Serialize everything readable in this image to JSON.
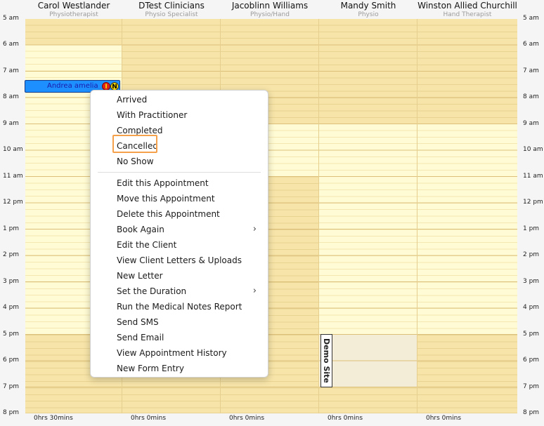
{
  "practitioners": [
    {
      "name": "Carol Westlander",
      "role": "Physiotherapist",
      "footer": "0hrs 30mins"
    },
    {
      "name": "DTest Clinicians",
      "role": "Physio Specialist",
      "footer": "0hrs 0mins"
    },
    {
      "name": "Jacoblinn Williams",
      "role": "Physio/Hand",
      "footer": "0hrs 0mins"
    },
    {
      "name": "Mandy Smith",
      "role": "Physio",
      "footer": "0hrs 0mins"
    },
    {
      "name": "Winston Allied Churchill",
      "role": "Hand Therapist",
      "footer": "0hrs 0mins"
    }
  ],
  "times": [
    "5 am",
    "6 am",
    "7 am",
    "8 am",
    "9 am",
    "10 am",
    "11 am",
    "12 pm",
    "1 pm",
    "2 pm",
    "3 pm",
    "4 pm",
    "5 pm",
    "6 pm",
    "7 pm",
    "8 pm"
  ],
  "appointment": {
    "client": "Andrea amelia",
    "badge_i": "I",
    "badge_n": "N"
  },
  "demo_site_label": "Demo Site",
  "context_menu": {
    "status_items": [
      "Arrived",
      "With Practitioner",
      "Completed",
      "Cancelled",
      "No Show"
    ],
    "action_items": [
      {
        "label": "Edit this Appointment"
      },
      {
        "label": "Move this Appointment"
      },
      {
        "label": "Delete this Appointment"
      },
      {
        "label": "Book Again",
        "submenu": true
      },
      {
        "label": "Edit the Client"
      },
      {
        "label": "View Client Letters & Uploads"
      },
      {
        "label": "New Letter"
      },
      {
        "label": "Set the Duration",
        "submenu": true
      },
      {
        "label": "Run the Medical Notes Report"
      },
      {
        "label": "Send SMS"
      },
      {
        "label": "Send Email"
      },
      {
        "label": "View Appointment History"
      },
      {
        "label": "New Form Entry"
      }
    ],
    "highlighted": "Cancelled"
  },
  "colors": {
    "unavailable": "#f6e4a8",
    "available": "#fffbd4",
    "appointment": "#1e8fff",
    "focus": "#f5a04a"
  }
}
